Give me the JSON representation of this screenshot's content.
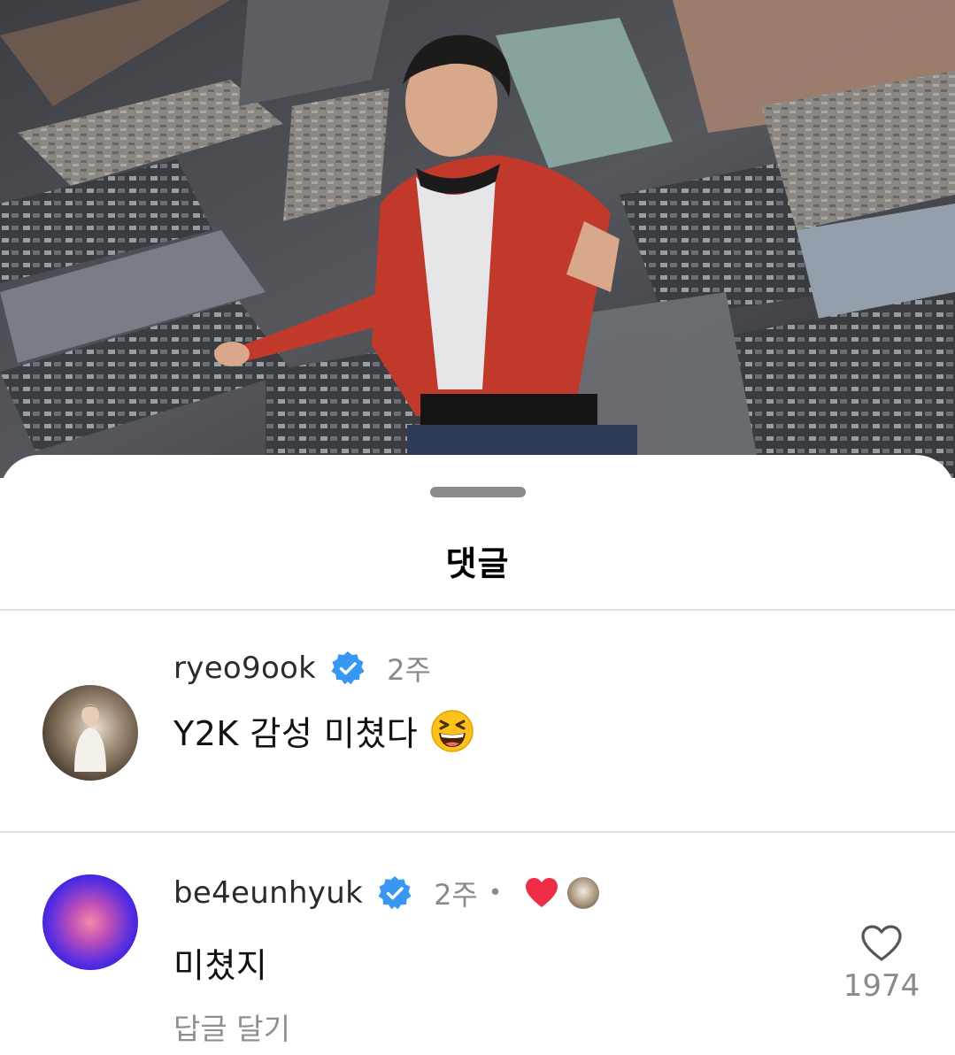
{
  "sheet": {
    "title": "댓글"
  },
  "comments": [
    {
      "username": "ryeo9ook",
      "verified": true,
      "time": "2주",
      "text": "Y2K 감성 미쳤다",
      "emoji": "grinning-squinting-face"
    },
    {
      "username": "be4eunhyuk",
      "verified": true,
      "time": "2주",
      "separator": "•",
      "liked_by_author": true,
      "text": "미쳤지",
      "reply_label": "답글 달기",
      "like_count": "1974"
    }
  ],
  "colors": {
    "verified_badge": "#3897f0",
    "heart_red": "#ed2c47",
    "muted_text": "#8a8a8a"
  }
}
